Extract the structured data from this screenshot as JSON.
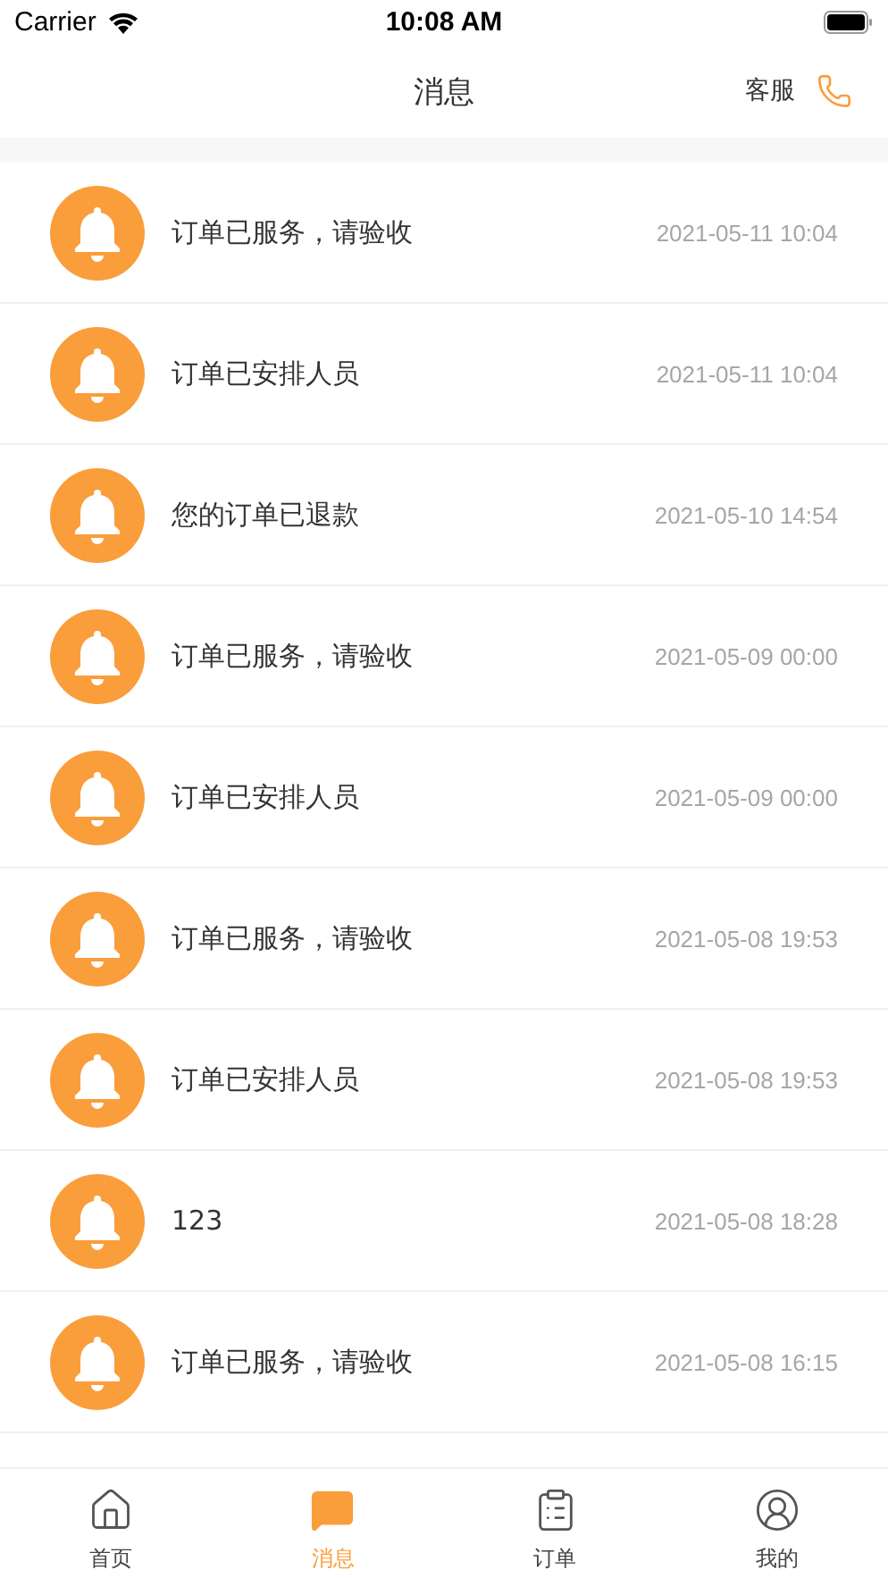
{
  "status_bar": {
    "carrier": "Carrier",
    "time": "10:08 AM"
  },
  "nav": {
    "title": "消息",
    "action": "客服"
  },
  "messages": [
    {
      "text": "订单已服务，请验收",
      "time": "2021-05-11 10:04"
    },
    {
      "text": "订单已安排人员",
      "time": "2021-05-11 10:04"
    },
    {
      "text": "您的订单已退款",
      "time": "2021-05-10 14:54"
    },
    {
      "text": "订单已服务，请验收",
      "time": "2021-05-09 00:00"
    },
    {
      "text": "订单已安排人员",
      "time": "2021-05-09 00:00"
    },
    {
      "text": "订单已服务，请验收",
      "time": "2021-05-08 19:53"
    },
    {
      "text": "订单已安排人员",
      "time": "2021-05-08 19:53"
    },
    {
      "text": "123",
      "time": "2021-05-08 18:28"
    },
    {
      "text": "订单已服务，请验收",
      "time": "2021-05-08 16:15"
    }
  ],
  "tabs": [
    {
      "kind": "home",
      "label": "首页",
      "selected": false
    },
    {
      "kind": "message",
      "label": "消息",
      "selected": true
    },
    {
      "kind": "order",
      "label": "订单",
      "selected": false
    },
    {
      "kind": "profile",
      "label": "我的",
      "selected": false
    }
  ]
}
